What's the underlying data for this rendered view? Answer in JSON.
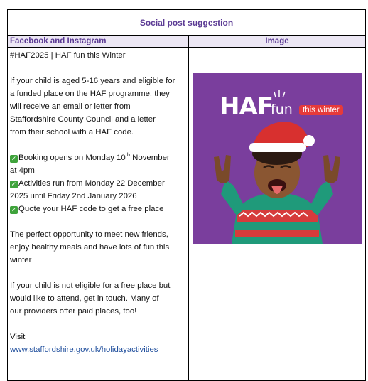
{
  "document": {
    "title": "Social post suggestion",
    "col_left_header": "Facebook and Instagram",
    "col_right_header": "Image"
  },
  "post": {
    "headline": "#HAF2025 | HAF fun this Winter",
    "intro": [
      "If your child is aged 5-16 years and eligible for",
      "a funded place on the HAF programme, they",
      "will receive an email or letter from",
      "Staffordshire County Council and a letter",
      "from their school with a HAF code."
    ],
    "booking_a": "Booking opens on Monday 10",
    "booking_sup": "th",
    "booking_b": " November",
    "booking_c": "at 4pm",
    "activities_a": "Activities run from Monday 22 December",
    "activities_b": "2025 until Friday 2nd January 2026",
    "quote": "Quote your HAF code to get a free place",
    "opportunity": [
      "The perfect opportunity to meet new friends,",
      "enjoy healthy meals and have lots of fun this",
      "winter"
    ],
    "not_eligible": [
      "If your child is not eligible for a free place but",
      "would like to attend, get in touch. Many of",
      "our providers offer paid places, too!"
    ],
    "visit_label": "Visit",
    "visit_link": "www.staffordshire.gov.uk/holidayactivities"
  },
  "image": {
    "logo_main": "HAF",
    "logo_sub": "fun",
    "logo_tag": "this winter",
    "background_color": "#7a3e9d",
    "tag_color": "#e63a3a"
  },
  "icons": {
    "check": "check-box-icon"
  }
}
